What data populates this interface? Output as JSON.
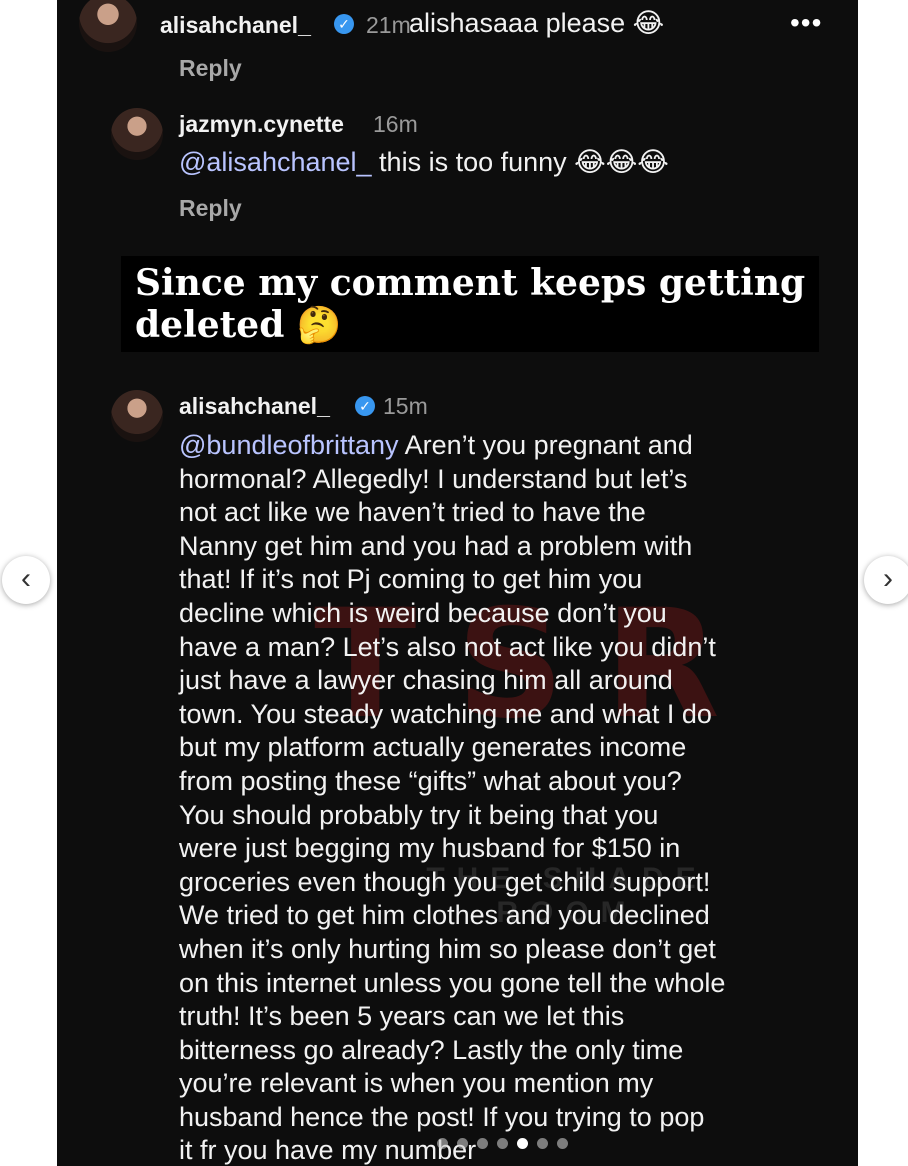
{
  "header": {
    "username": "alisahchanel_",
    "time": "21m",
    "text": "alishasaaa please 😂",
    "more_label": "•••",
    "reply_label": "Reply"
  },
  "comments": [
    {
      "username": "jazmyn.cynette",
      "time": "16m",
      "mention": "@alisahchanel_",
      "text": " this is too funny 😂😂😂",
      "reply_label": "Reply"
    },
    {
      "username": "alisahchanel_",
      "verified": true,
      "time": "15m",
      "lines": [
        "Aren’t you pregnant and",
        "hormonal? Allegedly! I understand but let’s",
        "not act like we haven’t tried to have the",
        "Nanny get him and you had a problem with",
        "that! If it’s not Pj coming to get him you",
        "decline which is weird because don’t you",
        "have a man? Let’s also not act like you didn’t",
        "just have a lawyer chasing him all around",
        "town. You steady watching me and what I do",
        "but my platform actually generates income",
        "from posting these “gifts” what about you?",
        "You should probably try it being that you",
        "were just begging my husband for $150 in",
        "groceries even though you get child support!",
        "We tried to get him clothes and you declined",
        "when it’s only hurting him so please don’t get",
        "on this internet unless you gone tell the whole",
        "truth! It’s been 5 years can we let this",
        "bitterness go already? Lastly the only time",
        "you’re relevant is when you mention my",
        "husband hence the post! If you trying to pop",
        "it fr you have my number"
      ],
      "mention": "@bundleofbrittany"
    }
  ],
  "caption": {
    "line1": "Since my comment keeps getting",
    "line2": "deleted 🤔"
  },
  "watermark": {
    "letters": "TSR",
    "subtitle": "THE SHADE ROOM"
  },
  "navigation": {
    "prev_label": "‹",
    "next_label": "›"
  },
  "pagination": {
    "total": 7,
    "active_index": 4
  },
  "colors": {
    "mention": "#b9c4ff",
    "verified": "#3897f0",
    "background": "#0d0d0d"
  }
}
